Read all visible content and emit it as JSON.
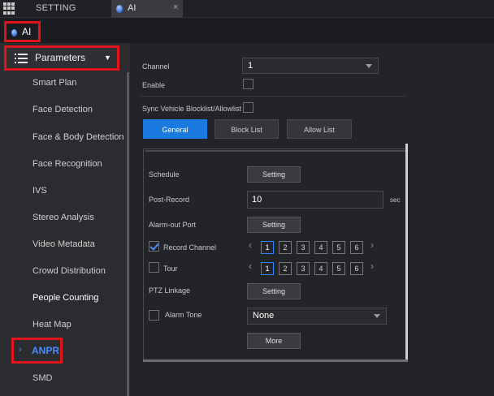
{
  "tabs": {
    "setting_label": "SETTING",
    "ai_label": "AI",
    "close_glyph": "×"
  },
  "breadcrumb": {
    "label": "AI"
  },
  "sidebar": {
    "header_label": "Parameters",
    "items": [
      {
        "label": "Smart Plan"
      },
      {
        "label": "Face Detection"
      },
      {
        "label": "Face & Body Detection"
      },
      {
        "label": "Face Recognition"
      },
      {
        "label": "IVS"
      },
      {
        "label": "Stereo Analysis"
      },
      {
        "label": "Video Metadata"
      },
      {
        "label": "Crowd Distribution"
      },
      {
        "label": "People Counting"
      },
      {
        "label": "Heat Map"
      },
      {
        "label": "ANPR"
      },
      {
        "label": "SMD"
      }
    ],
    "selected": "ANPR"
  },
  "main": {
    "channel_label": "Channel",
    "channel_value": "1",
    "enable_label": "Enable",
    "sync_label": "Sync Vehicle Blocklist/Allowlist",
    "tabs": [
      {
        "label": "General"
      },
      {
        "label": "Block List"
      },
      {
        "label": "Allow List"
      }
    ],
    "schedule_label": "Schedule",
    "schedule_button": "Setting",
    "post_record_label": "Post-Record",
    "post_record_value": "10",
    "post_record_unit": "sec",
    "alarm_out_label": "Alarm-out Port",
    "alarm_out_button": "Setting",
    "record_channel_label": "Record Channel",
    "record_channels": [
      "1",
      "2",
      "3",
      "4",
      "5",
      "6"
    ],
    "tour_label": "Tour",
    "tour_channels": [
      "1",
      "2",
      "3",
      "4",
      "5",
      "6"
    ],
    "ptz_label": "PTZ Linkage",
    "ptz_button": "Setting",
    "alarm_tone_label": "Alarm Tone",
    "alarm_tone_value": "None",
    "more_button": "More"
  },
  "colors": {
    "accent": "#1a7ae0",
    "highlight_box": "#e0141b",
    "selected_item": "#4a8cff"
  }
}
